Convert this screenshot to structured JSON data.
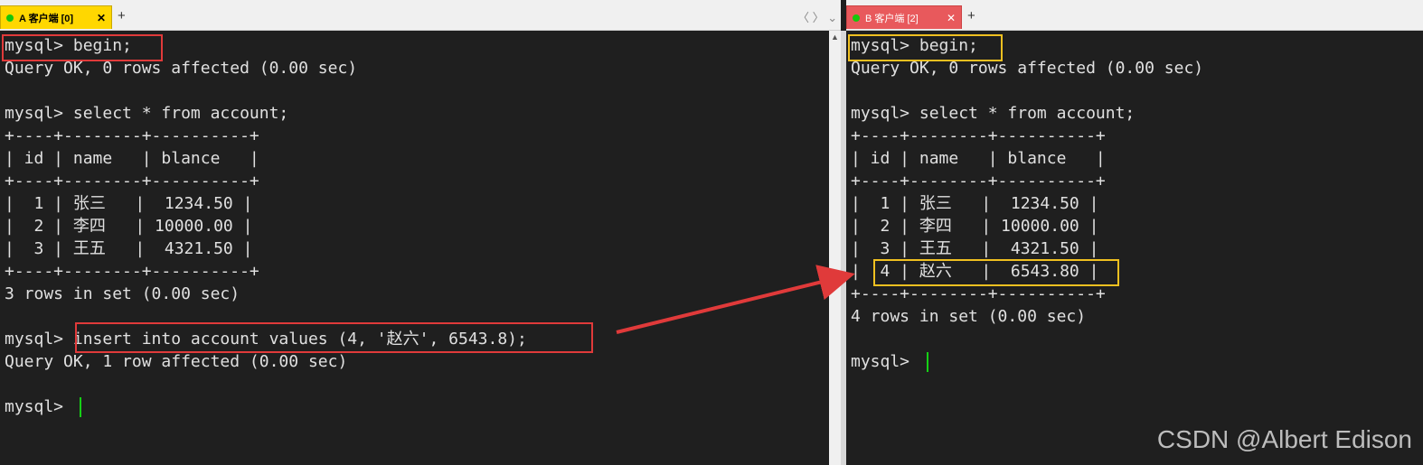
{
  "tabs": {
    "a": {
      "label": "A 客户端 [0]",
      "close": "✕"
    },
    "b": {
      "label": "B 客户端 [2]",
      "close": "✕"
    },
    "add": "+",
    "nav": "〈 〉 ⌄"
  },
  "pane_a": {
    "lines": [
      "mysql> begin;",
      "Query OK, 0 rows affected (0.00 sec)",
      "",
      "mysql> select * from account;",
      "+----+--------+----------+",
      "| id | name   | blance   |",
      "+----+--------+----------+",
      "|  1 | 张三   |  1234.50 |",
      "|  2 | 李四   | 10000.00 |",
      "|  3 | 王五   |  4321.50 |",
      "+----+--------+----------+",
      "3 rows in set (0.00 sec)",
      "",
      "mysql> insert into account values (4, '赵六', 6543.8);",
      "Query OK, 1 row affected (0.00 sec)",
      "",
      "mysql> "
    ]
  },
  "pane_b": {
    "lines": [
      "mysql> begin;",
      "Query OK, 0 rows affected (0.00 sec)",
      "",
      "mysql> select * from account;",
      "+----+--------+----------+",
      "| id | name   | blance   |",
      "+----+--------+----------+",
      "|  1 | 张三   |  1234.50 |",
      "|  2 | 李四   | 10000.00 |",
      "|  3 | 王五   |  4321.50 |",
      "|  4 | 赵六   |  6543.80 |",
      "+----+--------+----------+",
      "4 rows in set (0.00 sec)",
      "",
      "mysql> "
    ]
  },
  "watermark": "CSDN @Albert Edison",
  "colors": {
    "terminal_bg": "#1f1f1f",
    "terminal_text": "#e0e0e0",
    "highlight_red": "#e03a3a",
    "highlight_yellow": "#f0c020",
    "tab_a": "#ffd700",
    "tab_b": "#e8595c",
    "cursor": "#15d015"
  }
}
